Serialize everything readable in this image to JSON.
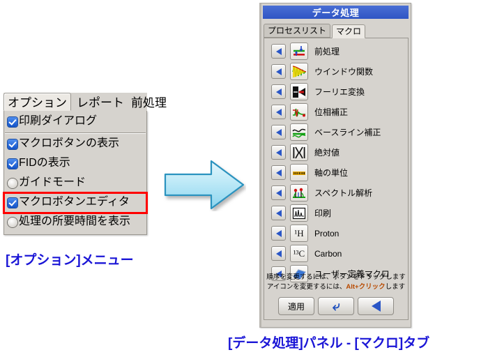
{
  "options_menu": {
    "menubar": [
      {
        "label": "オプション",
        "active": true
      },
      {
        "label": "レポート",
        "active": false
      },
      {
        "label": "前処理",
        "active": false
      }
    ],
    "items": [
      {
        "label": "印刷ダイアログ",
        "state": "checked",
        "highlighted": false,
        "separator_after": true
      },
      {
        "label": "マクロボタンの表示",
        "state": "checked",
        "highlighted": false,
        "separator_after": false
      },
      {
        "label": "FIDの表示",
        "state": "checked",
        "highlighted": false,
        "separator_after": false
      },
      {
        "label": "ガイドモード",
        "state": "unchecked",
        "highlighted": false,
        "separator_after": false
      },
      {
        "label": "マクロボタンエディタ",
        "state": "checked",
        "highlighted": true,
        "separator_after": false
      },
      {
        "label": "処理の所要時間を表示",
        "state": "unchecked",
        "highlighted": false,
        "separator_after": false
      }
    ],
    "caption": "[オプション]メニュー",
    "highlight_color": "#ff0000",
    "caption_color": "#1a15d6"
  },
  "arrow": {
    "icon": "right-arrow-icon",
    "fill_light": "#d8f0fb",
    "fill_dark": "#8fd6ef",
    "stroke": "#2292bf"
  },
  "data_processing_panel": {
    "title": "データ処理",
    "title_bar_color": "#3357c8",
    "tabs": [
      {
        "label": "プロセスリスト",
        "selected": false
      },
      {
        "label": "マクロ",
        "selected": true
      }
    ],
    "macro_rows": [
      {
        "label": "前処理",
        "icon": "preprocess-icon",
        "glyph": ""
      },
      {
        "label": "ウインドウ関数",
        "icon": "window-function-icon",
        "glyph": ""
      },
      {
        "label": "フーリエ変換",
        "icon": "fourier-transform-icon",
        "glyph": ""
      },
      {
        "label": "位相補正",
        "icon": "phase-correction-icon",
        "glyph": ""
      },
      {
        "label": "ベースライン補正",
        "icon": "baseline-correction-icon",
        "glyph": ""
      },
      {
        "label": "絶対値",
        "icon": "absolute-value-icon",
        "glyph": ""
      },
      {
        "label": "軸の単位",
        "icon": "axis-unit-icon",
        "glyph": ""
      },
      {
        "label": "スペクトル解析",
        "icon": "spectrum-analysis-icon",
        "glyph": ""
      },
      {
        "label": "印刷",
        "icon": "print-icon",
        "glyph": ""
      },
      {
        "label": "Proton",
        "icon": "proton-icon",
        "glyph": "¹H"
      },
      {
        "label": "Carbon",
        "icon": "carbon-icon",
        "glyph": "¹³C"
      },
      {
        "label": "ユーザー定義マクロ",
        "icon": "user-defined-macro-icon",
        "glyph": ""
      }
    ],
    "hint_line1": "順序を変更するには、ボタンをドラッグします",
    "hint_line2_pre": "アイコンを変更するには、",
    "hint_line2_key": "Alt+クリック",
    "hint_line2_post": "します",
    "buttons": [
      {
        "label": "適用",
        "icon": "apply-button"
      },
      {
        "label": "",
        "icon": "undo-icon"
      },
      {
        "label": "",
        "icon": "back-arrow-icon"
      }
    ],
    "caption": "[データ処理]パネル - [マクロ]タブ"
  }
}
